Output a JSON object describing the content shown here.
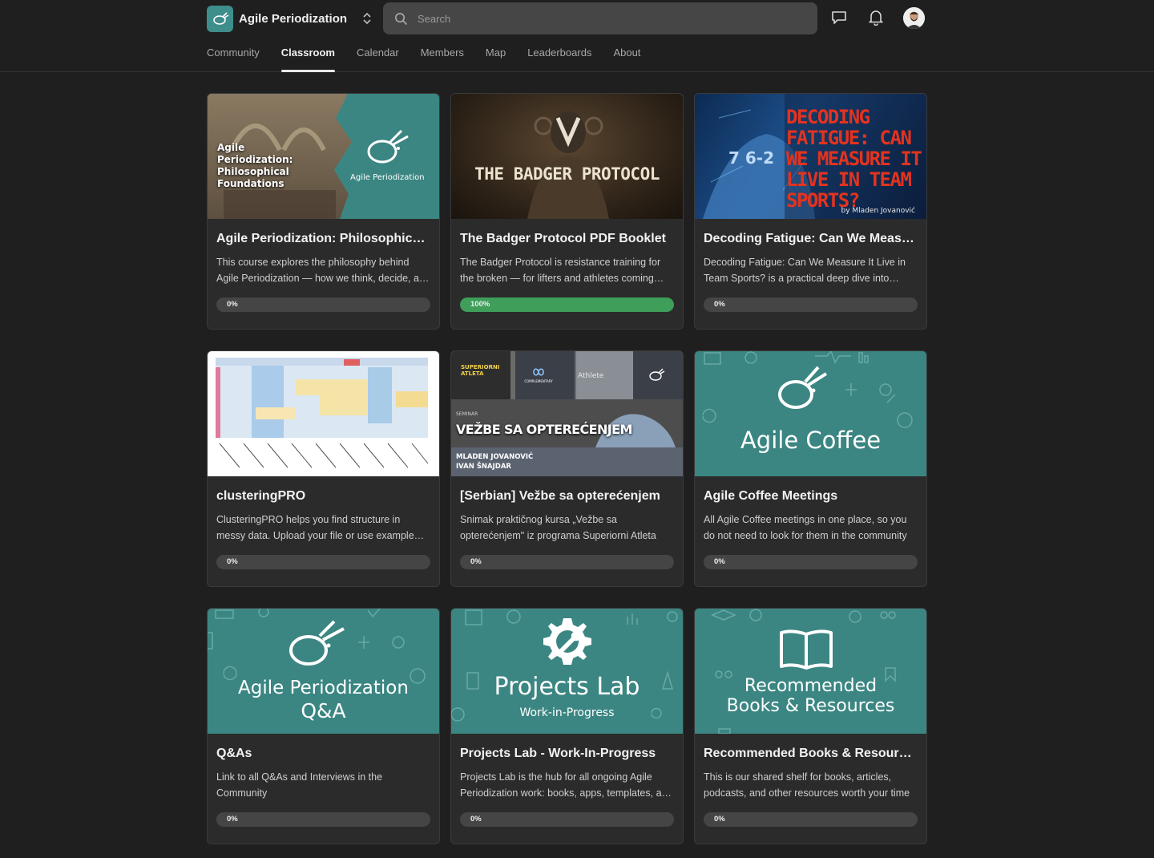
{
  "header": {
    "community_name": "Agile Periodization",
    "search_placeholder": "Search"
  },
  "nav": {
    "tabs": [
      {
        "label": "Community"
      },
      {
        "label": "Classroom"
      },
      {
        "label": "Calendar"
      },
      {
        "label": "Members"
      },
      {
        "label": "Map"
      },
      {
        "label": "Leaderboards"
      },
      {
        "label": "About"
      }
    ],
    "active_tab": "Classroom"
  },
  "courses": [
    {
      "title": "Agile Periodization: Philosophical Foundations",
      "description": "This course explores the philosophy behind Agile Periodization — how we think, decide, and act",
      "progress": 0,
      "progress_label": "0%",
      "thumb_text": "Agile Periodization: Philosophical Foundations",
      "thumb_brand": "Agile Periodization"
    },
    {
      "title": "The Badger Protocol PDF Booklet",
      "description": "The Badger Protocol is resistance training for the broken — for lifters and athletes coming back",
      "progress": 100,
      "progress_label": "100%",
      "thumb_text": "THE BADGER PROTOCOL"
    },
    {
      "title": "Decoding Fatigue: Can We Measure It Live in Team Sports?",
      "description": "Decoding Fatigue: Can We Measure It Live in Team Sports? is a practical deep dive into monitoring",
      "progress": 0,
      "progress_label": "0%",
      "thumb_text": "DECODING FATIGUE: CAN WE MEASURE IT LIVE IN TEAM SPORTS?",
      "thumb_byline": "by Mladen Jovanović",
      "thumb_digits": "7 6-2"
    },
    {
      "title": "clusteringPRO",
      "description": "ClusteringPRO helps you find structure in messy data. Upload your file or use example datasets",
      "progress": 0,
      "progress_label": "0%"
    },
    {
      "title": "[Serbian] Vežbe sa opterećenjem",
      "description": "Snimak praktičnog kursa „Vežbe sa opterećenjem\" iz programa Superiorni Atleta",
      "progress": 0,
      "progress_label": "0%",
      "thumb_text": "VEŽBE SA OPTEREĆENJEM",
      "thumb_authors_1": "MLADEN JOVANOVIĆ",
      "thumb_authors_2": "IVAN ŠNAJDAR",
      "thumb_seminar": "SEMINAR",
      "thumb_complementary": "COMPLEMENTARY",
      "thumb_athlete": "Athlete",
      "thumb_superior": "SUPERIORNI ATLETA"
    },
    {
      "title": "Agile Coffee Meetings",
      "description": "All Agile Coffee meetings in one place, so you do not need to look for them in the community",
      "progress": 0,
      "progress_label": "0%",
      "thumb_text": "Agile Coffee"
    },
    {
      "title": "Q&As",
      "description": "Link to all Q&As and Interviews in the Community",
      "progress": 0,
      "progress_label": "0%",
      "thumb_text_1": "Agile Periodization",
      "thumb_text_2": "Q&A"
    },
    {
      "title": "Projects Lab - Work-In-Progress",
      "description": "Projects Lab is the hub for all ongoing Agile Periodization work: books, apps, templates, and more",
      "progress": 0,
      "progress_label": "0%",
      "thumb_text": "Projects Lab",
      "thumb_sub": "Work-in-Progress"
    },
    {
      "title": "Recommended Books & Resources",
      "description": "This is our shared shelf for books, articles, podcasts, and other resources worth your time",
      "progress": 0,
      "progress_label": "0%",
      "thumb_text_1": "Recommended",
      "thumb_text_2": "Books & Resources"
    }
  ],
  "colors": {
    "background": "#1f1f1f",
    "card": "#2b2b2b",
    "teal": "#3b8682",
    "progress_complete": "#3e9e5a",
    "progress_track": "#454545"
  },
  "icons": [
    "search-icon",
    "chevron-updown-icon",
    "chat-icon",
    "bell-icon",
    "rabbit-logo-icon",
    "gear-wrench-icon",
    "book-icon"
  ]
}
